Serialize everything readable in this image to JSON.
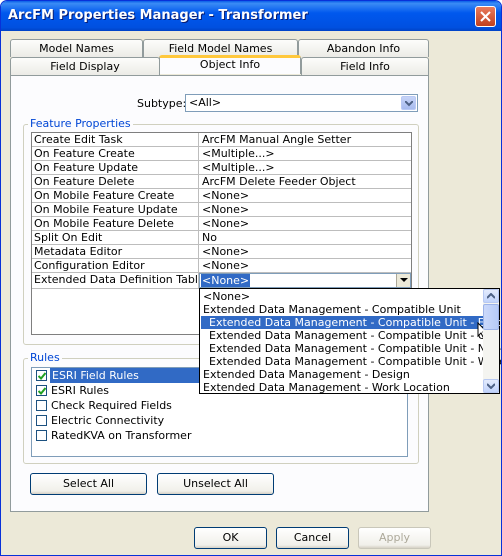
{
  "window": {
    "title": "ArcFM Properties Manager - Transformer"
  },
  "tabs": {
    "row_back": [
      "Model Names",
      "Field Model Names",
      "Abandon Info"
    ],
    "row_front": [
      "Field Display",
      "Object Info",
      "Field Info"
    ],
    "active": "Object Info"
  },
  "subtype": {
    "label": "Subtype:",
    "value": "<All>"
  },
  "feature_properties": {
    "title": "Feature Properties",
    "rows": [
      {
        "name": "Create Edit Task",
        "value": "ArcFM Manual Angle Setter"
      },
      {
        "name": "On Feature Create",
        "value": "<Multiple...>"
      },
      {
        "name": "On Feature Update",
        "value": "<Multiple...>"
      },
      {
        "name": "On Feature Delete",
        "value": "ArcFM Delete Feeder Object"
      },
      {
        "name": "On Mobile Feature Create",
        "value": "<None>"
      },
      {
        "name": "On Mobile Feature Update",
        "value": "<None>"
      },
      {
        "name": "On Mobile Feature Delete",
        "value": "<None>"
      },
      {
        "name": "Split On Edit",
        "value": "No"
      },
      {
        "name": "Metadata Editor",
        "value": "<None>"
      },
      {
        "name": "Configuration Editor",
        "value": "<None>"
      },
      {
        "name": "Extended Data Definition Table",
        "value": "<None>"
      }
    ]
  },
  "dropdown": {
    "items": [
      "<None>",
      "Extended Data Management - Compatible Unit",
      "Extended Data Management - Compatible Unit - Electric",
      "Extended Data Management - Compatible Unit - Gas",
      "Extended Data Management - Compatible Unit - Non-GIS",
      "Extended Data Management - Compatible Unit - Water",
      "Extended Data Management - Design",
      "Extended Data Management - Work Location"
    ],
    "selected_index": 2
  },
  "rules": {
    "title": "Rules",
    "items": [
      {
        "label": "ESRI Field Rules",
        "checked": true,
        "selected": true
      },
      {
        "label": "ESRI Rules",
        "checked": true,
        "selected": false
      },
      {
        "label": "Check Required Fields",
        "checked": false,
        "selected": false
      },
      {
        "label": "Electric Connectivity",
        "checked": false,
        "selected": false
      },
      {
        "label": "RatedKVA on Transformer",
        "checked": false,
        "selected": false
      }
    ]
  },
  "buttons": {
    "select_all": "Select All",
    "unselect_all": "Unselect All",
    "ok": "OK",
    "cancel": "Cancel",
    "apply": "Apply"
  },
  "colors": {
    "selection": "#316ac5",
    "group_title": "#0046d5",
    "tab_highlight": "#ffc83c"
  }
}
